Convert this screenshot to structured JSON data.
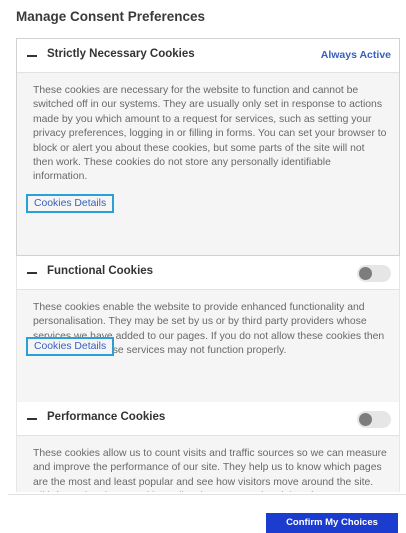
{
  "title": "Manage Consent Preferences",
  "sections": [
    {
      "heading": "Strictly Necessary Cookies",
      "status": "Always Active",
      "description": "These cookies are necessary for the website to function and cannot be switched off in our systems. They are usually only set in response to actions made by you which amount to a request for services, such as setting your privacy preferences, logging in or filling in forms. You can set your browser to block or alert you about these cookies, but some parts of the site will not then work. These cookies do not store any personally identifiable information.",
      "details_link": "Cookies Details"
    },
    {
      "heading": "Functional Cookies",
      "toggle_on": false,
      "description": "These cookies enable the website to provide enhanced functionality and personalisation. They may be set by us or by third party providers whose services we have added to our pages. If you do not allow these cookies then some or all of these services may not function properly.",
      "details_link": "Cookies Details"
    },
    {
      "heading": "Performance Cookies",
      "toggle_on": false,
      "description": "These cookies allow us to count visits and traffic sources so we can measure and improve the performance of our site. They help us to know which pages are the most and least popular and see how visitors move around the site. All information these cookies collect is aggregated and therefore anonymous. If you do not allow these cookies we will not know"
    }
  ],
  "confirm_button": "Confirm My Choices",
  "colors": {
    "accent": "#3860be",
    "button": "#1b3ccf",
    "link_focus": "#2a9fd8"
  }
}
